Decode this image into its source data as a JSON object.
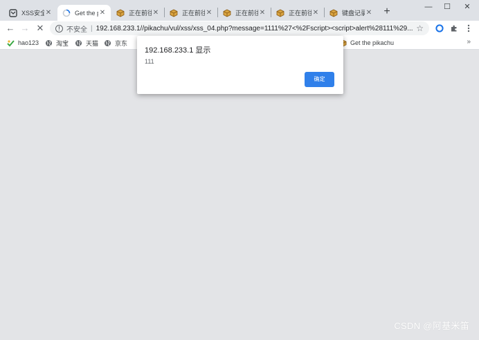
{
  "colors": {
    "accent": "#1a73e8",
    "page_background": "#e3e4e7",
    "tabstrip": "#dee1e6"
  },
  "tabs": [
    {
      "title": "XSS安全",
      "icon": "pikachu-icon"
    },
    {
      "title": "Get the p",
      "icon": "loading-icon",
      "active": true
    },
    {
      "title": "正在前往",
      "icon": "package-icon"
    },
    {
      "title": "正在前往",
      "icon": "package-icon"
    },
    {
      "title": "正在前往",
      "icon": "package-icon"
    },
    {
      "title": "正在前往",
      "icon": "package-icon"
    },
    {
      "title": "键盘记录",
      "icon": "package-icon"
    }
  ],
  "window_controls": {
    "minimize": "—",
    "maximize": "☐",
    "close": "✕"
  },
  "toolbar": {
    "back": "←",
    "forward": "→",
    "stop": "✕",
    "security_label": "不安全",
    "url": "192.168.233.1//pikachu/vul/xss/xss_04.php?message=1111%27<%2Fscript><script>alert%28111%29..."
  },
  "bookmarks": [
    {
      "label": "hao123",
      "icon": "hao123-icon"
    },
    {
      "label": "淘宝",
      "icon": "globe-icon"
    },
    {
      "label": "天猫",
      "icon": "globe-icon"
    },
    {
      "label": "京东",
      "icon": "globe-icon"
    },
    {
      "label": "Get the pikachu",
      "icon": "package-icon"
    }
  ],
  "bookmarks_more": "»",
  "dialog": {
    "origin": "192.168.233.1 显示",
    "message": "111",
    "ok_label": "确定"
  },
  "watermark": "CSDN @阿基米笛"
}
